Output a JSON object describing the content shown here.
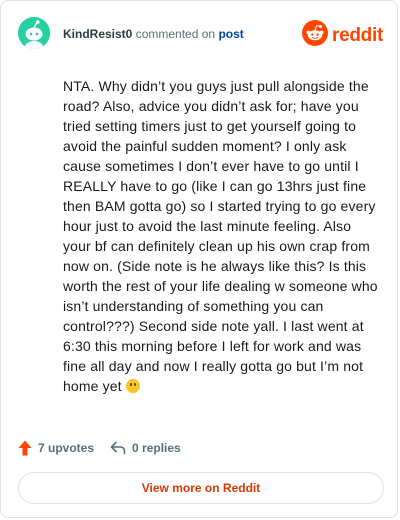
{
  "comment": {
    "username": "KindResist0",
    "action": "commented on",
    "post_link": "post",
    "body": "NTA. Why didn’t you guys just pull alongside the road? Also, advice you didn’t ask for; have you tried setting timers just to get yourself going to avoid the painful sudden moment? I only ask cause sometimes I don’t ever have to go until I REALLY have to go (like I can go 13hrs just fine then BAM gotta go) so I started trying to go every hour just to avoid the last minute feeling. Also your bf can definitely clean up his own crap from now on. (Side note is he always like this? Is this worth the rest of your life dealing w someone who isn’t understanding of something you can control???) Second side note yall. I last went at 6:30 this morning before I left for work and was fine all day and now I really gotta go but I’m not home yet",
    "emoji_icon": "upside-down-face-icon",
    "avatar_icon": "snoo-avatar-icon",
    "avatar_color": "#26d0a0"
  },
  "brand": {
    "name": "reddit",
    "icon": "reddit-logo-icon",
    "color": "#ff4500"
  },
  "stats": {
    "upvotes_label": "7 upvotes",
    "upvote_icon": "upvote-arrow-icon",
    "upvote_color": "#ff4500",
    "replies_label": "0 replies",
    "reply_icon": "reply-arrow-icon"
  },
  "cta": {
    "label": "View more on Reddit",
    "color": "#d93900"
  }
}
